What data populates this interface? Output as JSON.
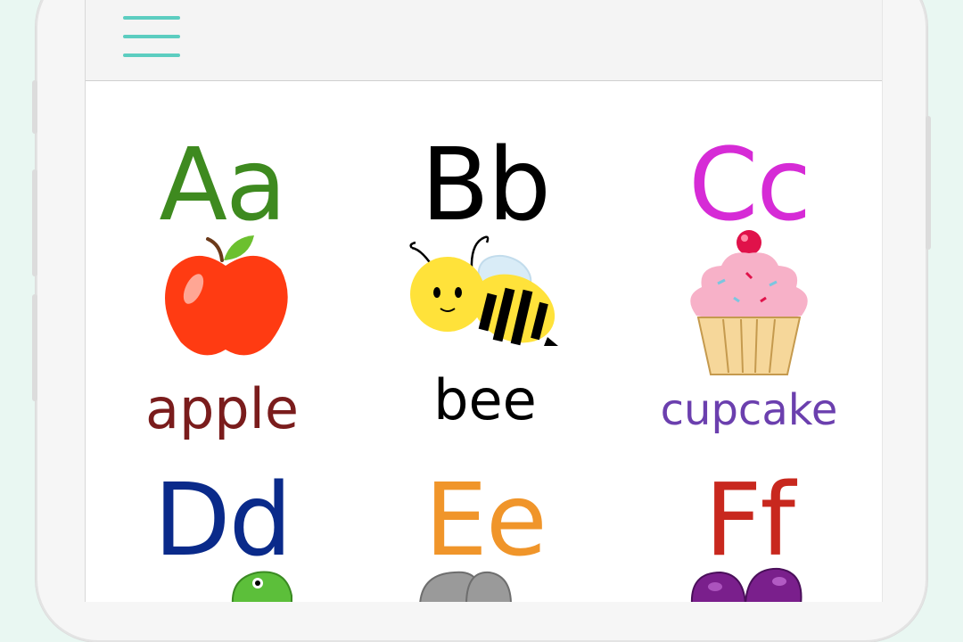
{
  "app": {
    "menu_icon": "hamburger-menu-icon",
    "accent_color": "#5ccdc0"
  },
  "cards": [
    {
      "letters": "Aa",
      "word": "apple",
      "letter_color": "#3e8a1f",
      "word_color": "#7a1c1c",
      "picture": "apple-icon"
    },
    {
      "letters": "Bb",
      "word": "bee",
      "letter_color": "#000000",
      "word_color": "#000000",
      "picture": "bee-icon"
    },
    {
      "letters": "Cc",
      "word": "cupcake",
      "letter_color": "#d62bd6",
      "word_color": "#6b3fae",
      "picture": "cupcake-icon"
    },
    {
      "letters": "Dd",
      "word": "",
      "letter_color": "#0a2a8a",
      "word_color": "",
      "picture": "dinosaur-icon"
    },
    {
      "letters": "Ee",
      "word": "",
      "letter_color": "#f0952a",
      "word_color": "",
      "picture": "elephant-icon"
    },
    {
      "letters": "Ff",
      "word": "",
      "letter_color": "#c8281e",
      "word_color": "",
      "picture": "fig-icon"
    }
  ]
}
